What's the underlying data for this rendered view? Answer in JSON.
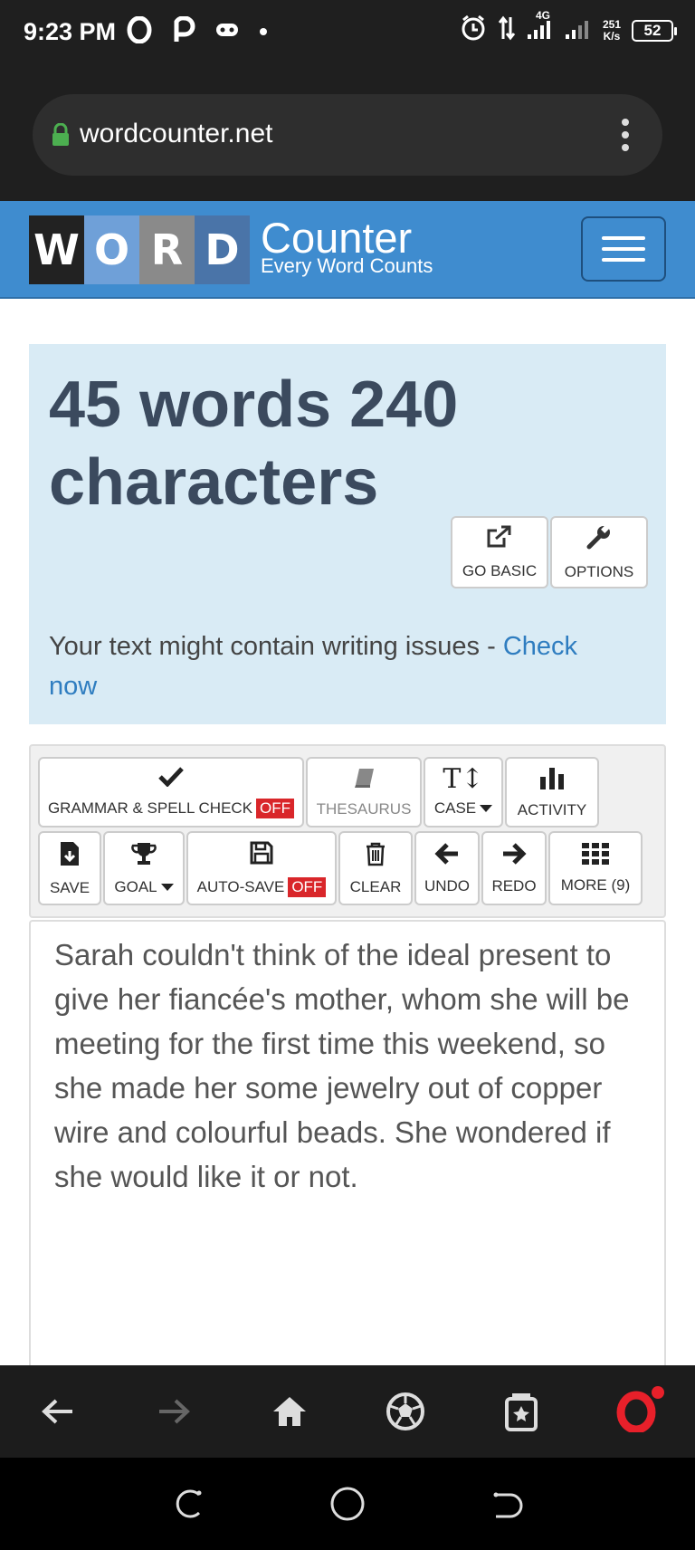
{
  "status_bar": {
    "time": "9:23 PM",
    "network_type": "4G",
    "speed_value": "251",
    "speed_unit": "K/s",
    "battery": "52",
    "icons": [
      "opera-icon",
      "p-icon",
      "gamepad-icon",
      "dot-icon",
      "alarm-icon",
      "data-arrows-icon",
      "signal-icon",
      "signal-icon-2"
    ]
  },
  "browser": {
    "url": "wordcounter.net",
    "lock_color": "#4caf50"
  },
  "site": {
    "logo_letters": [
      "W",
      "O",
      "R",
      "D"
    ],
    "logo_tile_colors": [
      "#222222",
      "#6fa0d8",
      "#8a8a8a",
      "#4a74a8"
    ],
    "logo_name": "Counter",
    "logo_tagline": "Every Word Counts",
    "header_color": "#3f8ccf"
  },
  "counts": {
    "title": "45 words 240 characters",
    "go_basic_label": "GO BASIC",
    "options_label": "OPTIONS",
    "issues_text": "Your text might contain writing issues - ",
    "issues_link": "Check now"
  },
  "toolbar": {
    "grammar_label": "GRAMMAR & SPELL CHECK",
    "grammar_state": "OFF",
    "thesaurus_label": "THESAURUS",
    "case_label": "CASE",
    "activity_label": "ACTIVITY",
    "save_label": "SAVE",
    "goal_label": "GOAL",
    "autosave_label": "AUTO-SAVE",
    "autosave_state": "OFF",
    "clear_label": "CLEAR",
    "undo_label": "UNDO",
    "redo_label": "REDO",
    "more_label": "MORE (9)"
  },
  "editor": {
    "text": "Sarah couldn't think of the ideal present to give her fiancée's mother, whom she will be meeting for the first time this weekend, so she made her some jewelry out of copper wire and colourful beads. She wondered if she would like it or not."
  },
  "browser_nav": [
    "back-icon",
    "forward-icon",
    "home-icon",
    "soccer-ball-icon",
    "tabs-icon",
    "opera-logo-icon"
  ],
  "system_nav": [
    "recents-icon",
    "home-circle-icon",
    "back-gesture-icon"
  ]
}
